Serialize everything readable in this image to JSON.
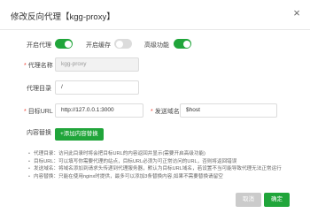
{
  "dialog": {
    "title": "修改反向代理【kgg-proxy】",
    "close_symbol": "×"
  },
  "toggles": [
    {
      "label": "开启代理",
      "on": true
    },
    {
      "label": "开启缓存",
      "on": false
    },
    {
      "label": "高级功能",
      "on": true
    }
  ],
  "form": {
    "proxy_name_label": "代理名称",
    "proxy_name_value": "kgg-proxy",
    "proxy_dir_label": "代理目录",
    "proxy_dir_value": "/",
    "target_url_label": "目标URL",
    "target_url_value": "http://127.0.0.1:3000",
    "send_domain_label": "发送域名",
    "send_domain_value": "$host",
    "content_replace_label": "内容替换",
    "add_replace_button": "+添加内容替换"
  },
  "notes": [
    "代理目录：访问此目录时将会把目标URL的内容返回并显示(需要开启高级功能)",
    "目标URL：可以填写你需要代理的站点，目标URL必须为可正常访问的URL，否则将返回错误",
    "发送域名：将域名添加到请求头传递到代理服务器，默认为目标URL域名，若设置不当可能导致代理无法正常运行",
    "内容替换：只能在使用nginx时提供，最多可以添加3条替换内容,如果不需要替换请留空"
  ],
  "footer": {
    "cancel_label": "取消",
    "confirm_label": "确定"
  },
  "colors": {
    "accent": "#20a53a",
    "required": "#f04134"
  }
}
